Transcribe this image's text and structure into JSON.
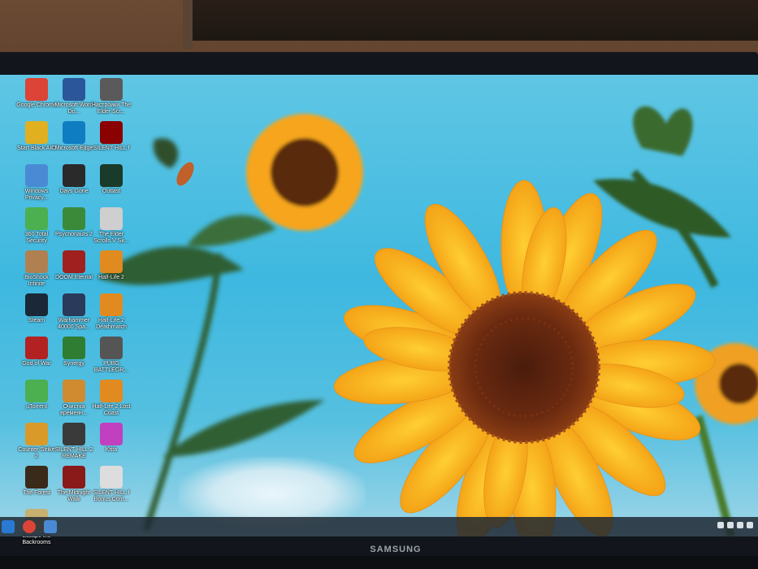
{
  "monitor": {
    "brand": "SAMSUNG"
  },
  "desktop": {
    "icons": [
      {
        "label": "Google Chrome",
        "icon": "chrome-icon",
        "color": "#db4437"
      },
      {
        "label": "Microsoft Word Do...",
        "icon": "word-icon",
        "color": "#2b579a"
      },
      {
        "label": "Настройки The Elder Scr...",
        "icon": "elder-scrolls-icon",
        "color": "#5a5a5a"
      },
      {
        "label": "Start Black AIO",
        "icon": "start-icon",
        "color": "#e0b020"
      },
      {
        "label": "Microsoft Edge",
        "icon": "edge-icon",
        "color": "#0f7dc2"
      },
      {
        "label": "SILENT HILL f",
        "icon": "silent-hill-icon",
        "color": "#8b0000"
      },
      {
        "label": "Windows Privacy...",
        "icon": "privacy-icon",
        "color": "#4a8ad4"
      },
      {
        "label": "Days Gone",
        "icon": "days-gone-icon",
        "color": "#2a2a2a"
      },
      {
        "label": "Outlast",
        "icon": "outlast-icon",
        "color": "#1a3a2a"
      },
      {
        "label": "360 Total Security",
        "icon": "security-icon",
        "color": "#4caf50"
      },
      {
        "label": "Psychonauts 2",
        "icon": "psychonauts-icon",
        "color": "#3a8a3a"
      },
      {
        "label": "The Elder Scrolls V Sk...",
        "icon": "skyrim-icon",
        "color": "#cfcfcf"
      },
      {
        "label": "BioShock Infinite",
        "icon": "bioshock-icon",
        "color": "#b08050"
      },
      {
        "label": "DOOM Eternal",
        "icon": "doom-icon",
        "color": "#a02020"
      },
      {
        "label": "Half-Life 2",
        "icon": "half-life-icon",
        "color": "#e08a20"
      },
      {
        "label": "Steam",
        "icon": "steam-icon",
        "color": "#1b2838"
      },
      {
        "label": "Warhammer 40000 Spa...",
        "icon": "warhammer-icon",
        "color": "#2a3a5a"
      },
      {
        "label": "Half-Life 2 Deathmatch",
        "icon": "hl2-dm-icon",
        "color": "#e08a20"
      },
      {
        "label": "God of War",
        "icon": "god-of-war-icon",
        "color": "#b22222"
      },
      {
        "label": "Synergy",
        "icon": "synergy-icon",
        "color": "#2e7d32"
      },
      {
        "label": "PUBG BATTLEGR...",
        "icon": "pubg-icon",
        "color": "#555555"
      },
      {
        "label": "µTorrent",
        "icon": "utorrent-icon",
        "color": "#4caf50"
      },
      {
        "label": "Очистка временн...",
        "icon": "cleanup-icon",
        "color": "#d08a30"
      },
      {
        "label": "Half-Life 2 Lost Coast",
        "icon": "hl2-lc-icon",
        "color": "#e08a20"
      },
      {
        "label": "Counter-Strike 2",
        "icon": "cs2-icon",
        "color": "#d99a2a"
      },
      {
        "label": "SILENT HILL 2 REMAKE",
        "icon": "sh2-icon",
        "color": "#3a3a3a"
      },
      {
        "label": "Krita",
        "icon": "krita-icon",
        "color": "#c040c0"
      },
      {
        "label": "The Forest",
        "icon": "forest-icon",
        "color": "#3a2a1a"
      },
      {
        "label": "The Midnight Walk",
        "icon": "midnight-walk-icon",
        "color": "#8a1a1a"
      },
      {
        "label": "SILENT HILL f Bonus Cont...",
        "icon": "sh-bonus-icon",
        "color": "#dddddd"
      },
      {
        "label": "Escape the Backrooms",
        "icon": "backrooms-icon",
        "color": "#c8b070"
      }
    ]
  },
  "taskbar": {
    "items": [
      {
        "icon": "start-menu-icon",
        "color": "#2a7ad4"
      },
      {
        "icon": "chrome-taskbar-icon",
        "color": "#db4437"
      },
      {
        "icon": "store-icon",
        "color": "#4a8ad4"
      }
    ]
  }
}
